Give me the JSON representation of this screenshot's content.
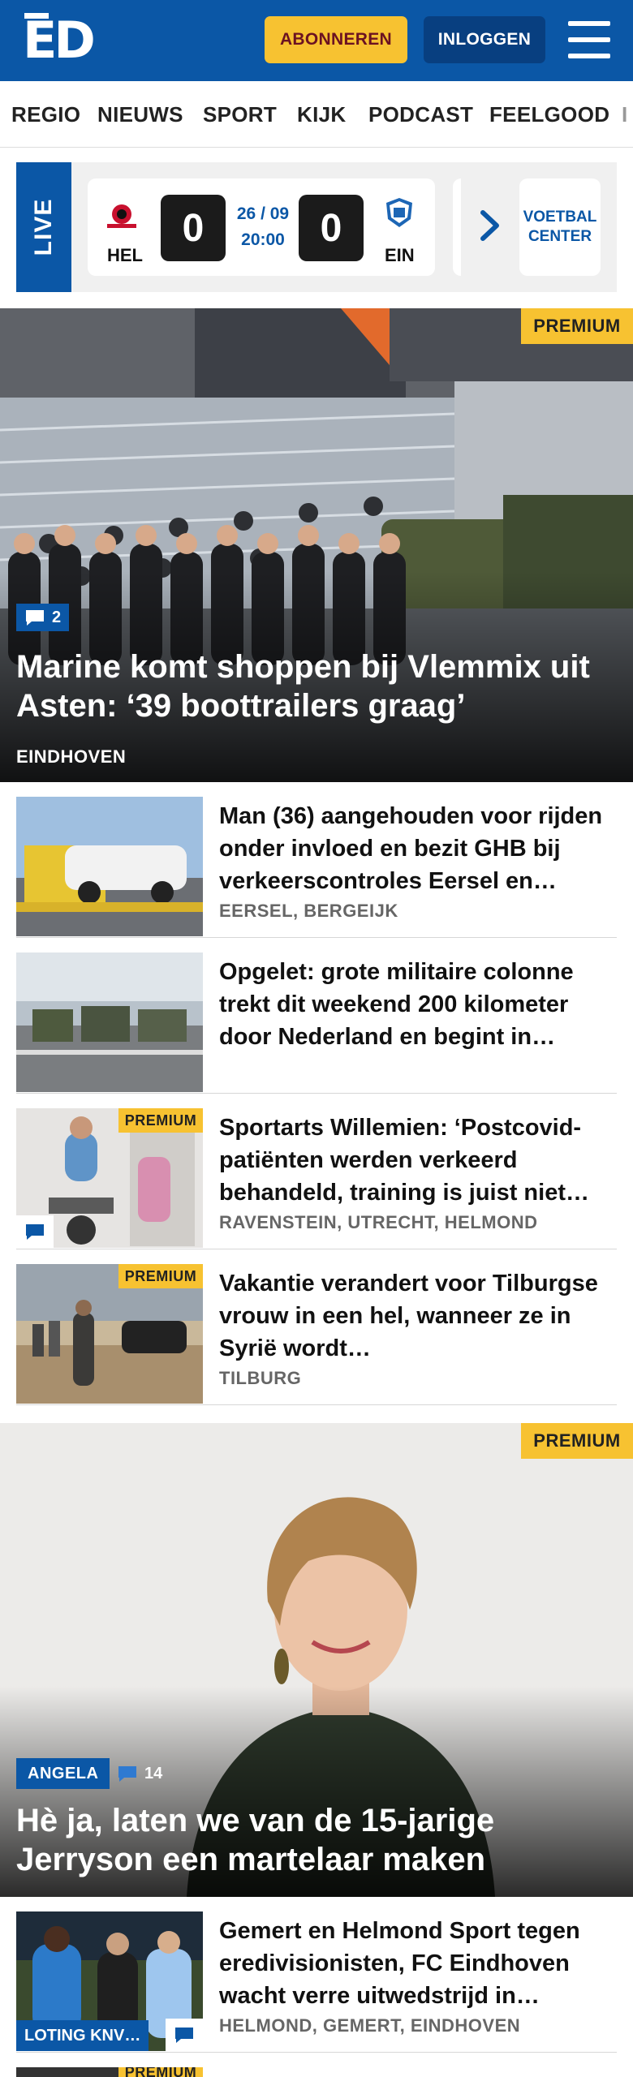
{
  "header": {
    "logo_text": "ED",
    "subscribe_label": "ABONNEREN",
    "login_label": "INLOGGEN",
    "menu_icon": "hamburger-menu-icon"
  },
  "nav": {
    "items": [
      "REGIO",
      "NIEUWS",
      "SPORT",
      "KIJK",
      "PODCAST",
      "FEELGOOD",
      "I"
    ]
  },
  "live": {
    "label": "LIVE",
    "match": {
      "home_team": "HEL",
      "home_score": "0",
      "date": "26 / 09",
      "time": "20:00",
      "away_score": "0",
      "away_team": "EIN"
    },
    "voetbal_center_line1": "VOETBAL",
    "voetbal_center_line2": "CENTER"
  },
  "hero1": {
    "premium": "PREMIUM",
    "comments": "2",
    "title": "Marine komt shoppen bij Vlemmix uit Asten: ‘39 boottrailers graag’",
    "location": "EINDHOVEN"
  },
  "articles": [
    {
      "title": "Man (36) aangehouden voor rijden onder invloed en bezit GHB bij verkeerscontroles Eersel en…",
      "location": "EERSEL, BERGEIJK",
      "premium": "",
      "has_comment": false
    },
    {
      "title": "Opgelet: grote militaire colonne trekt dit weekend 200 kilometer door Nederland en begint in…",
      "location": "",
      "premium": "",
      "has_comment": false
    },
    {
      "title": "Sportarts Willemien: ‘Postcovid-patiënten werden verkeerd behandeld, training is juist niet…",
      "location": "RAVENSTEIN, UTRECHT, HELMOND",
      "premium": "PREMIUM",
      "has_comment": true
    },
    {
      "title": "Vakantie verandert voor Tilburgse vrouw in een hel, wanneer ze in Syrië wordt…",
      "location": "TILBURG",
      "premium": "PREMIUM",
      "has_comment": false
    }
  ],
  "hero2": {
    "premium": "PREMIUM",
    "author_tag": "ANGELA",
    "comments": "14",
    "title": "Hè ja, laten we van de 15-jarige Jerryson een martelaar maken"
  },
  "article5": {
    "title": "Gemert en Helmond Sport tegen eredivisionisten, FC Eindhoven wacht verre uitwedstrijd in…",
    "location": "HELMOND, GEMERT, EINDHOVEN",
    "tag": "LOTING KNV…"
  },
  "article6": {
    "premium": "PREMIUM"
  },
  "colors": {
    "brand_blue": "#0b57a6",
    "premium_yellow": "#f7c231",
    "subscribe_text": "#6b1222"
  }
}
